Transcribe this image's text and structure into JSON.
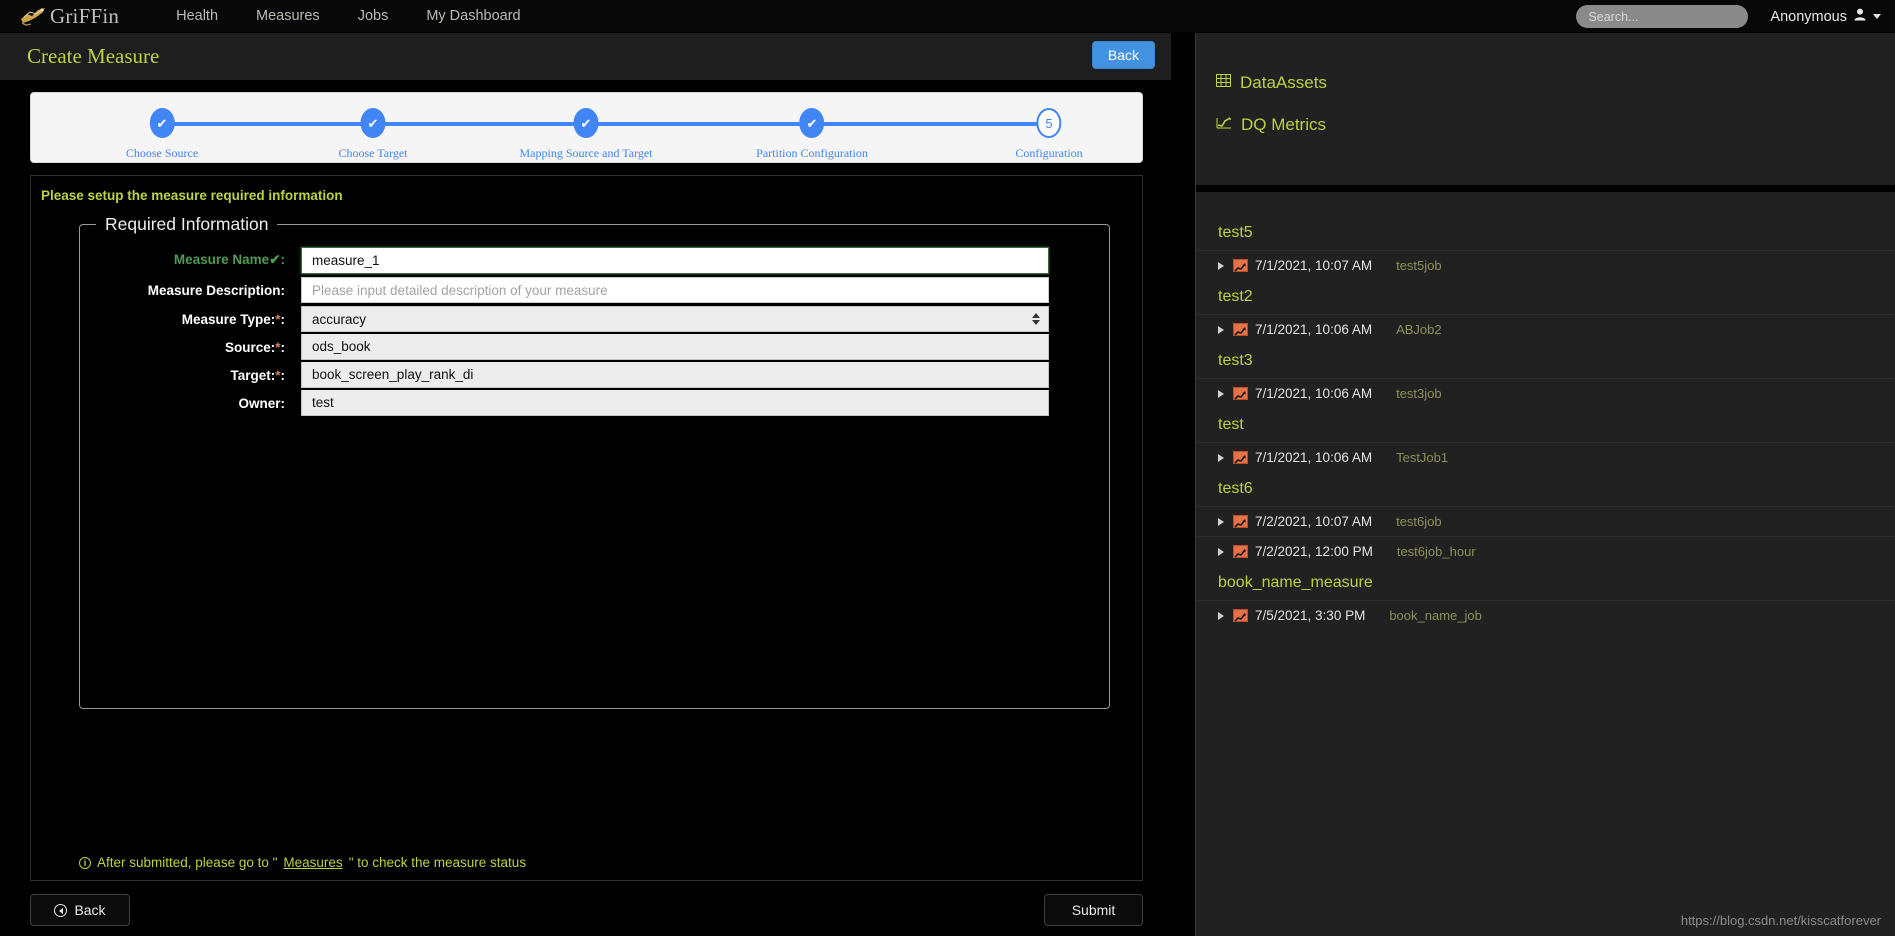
{
  "navbar": {
    "brand": "GriFFin",
    "links": [
      "Health",
      "Measures",
      "Jobs",
      "My Dashboard"
    ],
    "search_placeholder": "Search...",
    "user": "Anonymous"
  },
  "page": {
    "title": "Create Measure",
    "back_top_label": "Back"
  },
  "stepper": {
    "steps": [
      {
        "label": "Choose Source",
        "state": "done",
        "marker": "✔"
      },
      {
        "label": "Choose Target",
        "state": "done",
        "marker": "✔"
      },
      {
        "label": "Mapping Source and Target",
        "state": "done",
        "marker": "✔"
      },
      {
        "label": "Partition Configuration",
        "state": "done",
        "marker": "✔"
      },
      {
        "label": "Configuration",
        "state": "current",
        "marker": "5"
      }
    ]
  },
  "form": {
    "hint": "Please setup the measure required information",
    "legend": "Required Information",
    "fields": {
      "measure_name": {
        "label": "Measure Name",
        "suffix": "✔:",
        "value": "measure_1",
        "valid": true
      },
      "measure_description": {
        "label": "Measure Description:",
        "placeholder": "Please input detailed description of your measure",
        "value": ""
      },
      "measure_type": {
        "label": "Measure Type:",
        "required": "*",
        "colon": ":",
        "value": "accuracy"
      },
      "source": {
        "label": "Source:",
        "required": "*",
        "colon": ":",
        "value": "ods_book"
      },
      "target": {
        "label": "Target:",
        "required": "*",
        "colon": ":",
        "value": "book_screen_play_rank_di"
      },
      "owner": {
        "label": "Owner:",
        "value": "test"
      }
    },
    "footer_note_prefix": "After submitted, please go to \"",
    "footer_note_link": "Measures",
    "footer_note_suffix": "\" to check the measure status"
  },
  "bottom": {
    "back_label": "Back",
    "submit_label": "Submit"
  },
  "sidebar": {
    "entries": [
      {
        "label": "DataAssets",
        "icon": "⌸"
      },
      {
        "label": "DQ Metrics",
        "icon": "📈"
      }
    ],
    "groups": [
      {
        "name": "test5",
        "rows": [
          {
            "date": "7/1/2021, 10:07 AM",
            "job": "test5job"
          }
        ]
      },
      {
        "name": "test2",
        "rows": [
          {
            "date": "7/1/2021, 10:06 AM",
            "job": "ABJob2"
          }
        ]
      },
      {
        "name": "test3",
        "rows": [
          {
            "date": "7/1/2021, 10:06 AM",
            "job": "test3job"
          }
        ]
      },
      {
        "name": "test",
        "rows": [
          {
            "date": "7/1/2021, 10:06 AM",
            "job": "TestJob1"
          }
        ]
      },
      {
        "name": "test6",
        "rows": [
          {
            "date": "7/2/2021, 10:07 AM",
            "job": "test6job"
          },
          {
            "date": "7/2/2021, 12:00 PM",
            "job": "test6job_hour"
          }
        ]
      },
      {
        "name": "book_name_measure",
        "rows": [
          {
            "date": "7/5/2021, 3:30 PM",
            "job": "book_name_job"
          }
        ]
      }
    ],
    "watermark": "https://blog.csdn.net/kisscatforever"
  },
  "colors": {
    "accent_green": "#bcd23f",
    "step_blue": "#4285f4",
    "back_btn_blue": "#4292e0",
    "required_star": "#e07b5a",
    "valid_green": "#4f9a54",
    "chart_icon": "#e8714a"
  }
}
